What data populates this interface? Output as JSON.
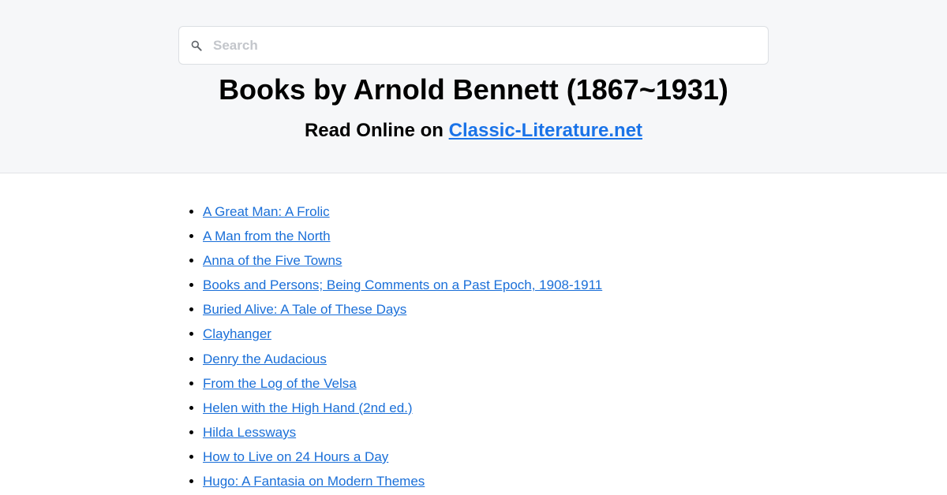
{
  "search": {
    "placeholder": "Search",
    "value": "",
    "icon": "search-icon"
  },
  "header": {
    "title": "Books by Arnold Bennett (1867~1931)",
    "subtitle_prefix": "Read Online on ",
    "subtitle_link": "Classic-Literature.net"
  },
  "books": [
    "A Great Man: A Frolic",
    "A Man from the North",
    "Anna of the Five Towns",
    "Books and Persons; Being Comments on a Past Epoch, 1908-1911",
    "Buried Alive: A Tale of These Days",
    "Clayhanger",
    "Denry the Audacious",
    "From the Log of the Velsa",
    "Helen with the High Hand (2nd ed.)",
    "Hilda Lessways",
    "How to Live on 24 Hours a Day",
    "Hugo: A Fantasia on Modern Themes"
  ]
}
